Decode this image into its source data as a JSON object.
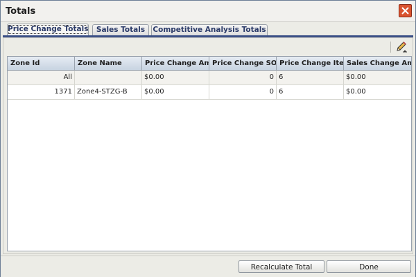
{
  "window": {
    "title": "Totals"
  },
  "tabs": [
    {
      "label": "Price Change Totals",
      "active": true
    },
    {
      "label": "Sales Totals",
      "active": false
    },
    {
      "label": "Competitive Analysis Totals",
      "active": false
    }
  ],
  "toolbar": {
    "edit_icon": "pencil-icon"
  },
  "table": {
    "headers": [
      "Zone Id",
      "Zone Name",
      "Price Change Amou",
      "Price Change SOH",
      "Price Change Item",
      "Sales Change Amou"
    ],
    "rows": [
      [
        "All",
        "",
        "$0.00",
        "0",
        "6",
        "$0.00"
      ],
      [
        "1371",
        "Zone4-STZG-B",
        "$0.00",
        "0",
        "6",
        "$0.00"
      ]
    ]
  },
  "footer": {
    "recalculate_label": "Recalculate Total",
    "done_label": "Done"
  },
  "colors": {
    "tab_underline": "#3a4f86",
    "close_button": "#d9532f",
    "header_bg": "#c7d3e1"
  }
}
